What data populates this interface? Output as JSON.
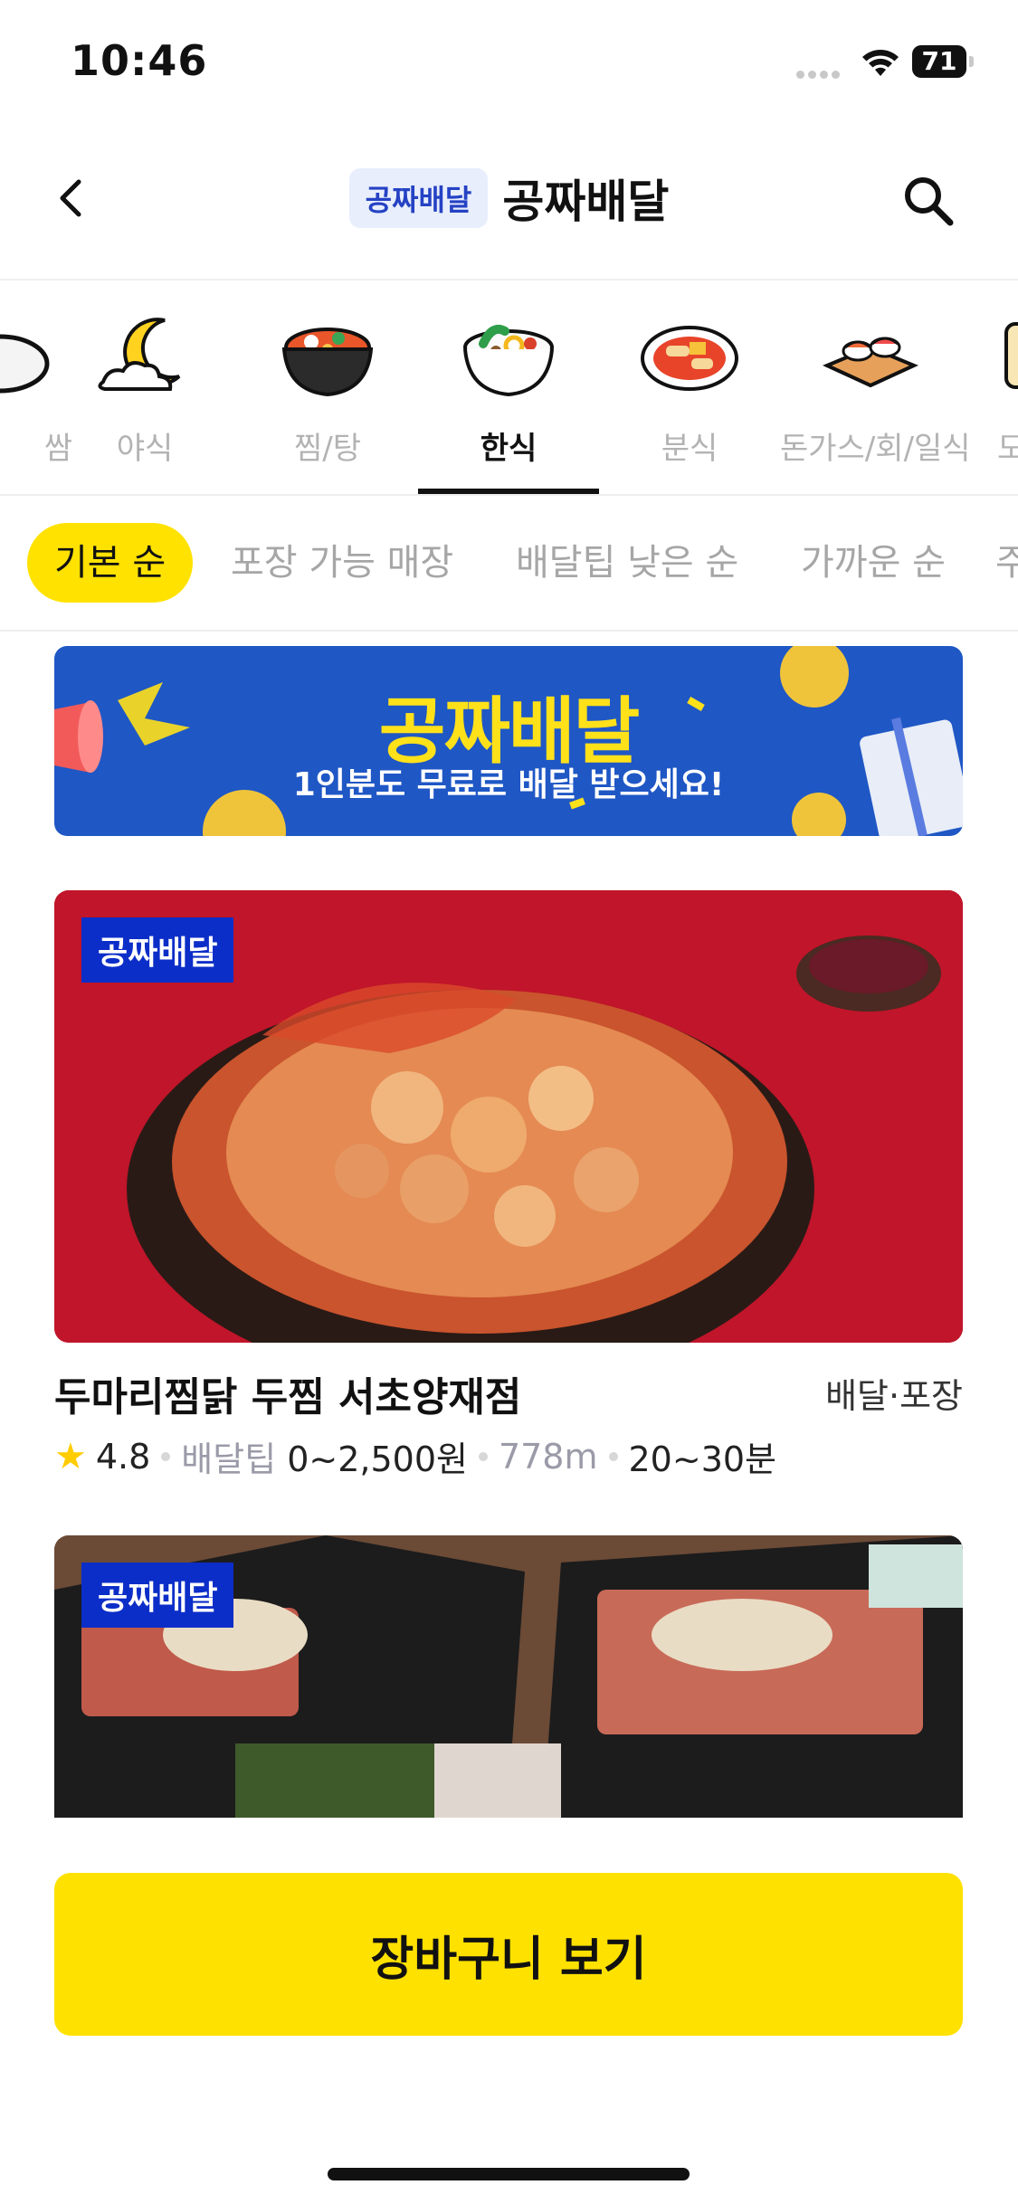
{
  "status_bar": {
    "time": "10:46",
    "battery": "71"
  },
  "header": {
    "badge": "공짜배달",
    "title": "공짜배달"
  },
  "categories": [
    {
      "label": "쌈",
      "icon": "wrap-icon"
    },
    {
      "label": "야식",
      "icon": "moon-icon"
    },
    {
      "label": "찜/탕",
      "icon": "stew-pot-icon"
    },
    {
      "label": "한식",
      "icon": "bibimbap-icon",
      "active": true
    },
    {
      "label": "분식",
      "icon": "tteokbokki-icon"
    },
    {
      "label": "돈가스/회/일식",
      "icon": "sushi-icon"
    },
    {
      "label": "도",
      "icon": "lunchbox-icon"
    }
  ],
  "filters": [
    {
      "label": "기본 순",
      "active": true
    },
    {
      "label": "포장 가능 매장"
    },
    {
      "label": "배달팁 낮은 순"
    },
    {
      "label": "가까운 순"
    },
    {
      "label": "주"
    }
  ],
  "banner": {
    "title": "공짜배달",
    "subtitle": "1인분도 무료로 배달 받으세요!"
  },
  "stores": [
    {
      "badge": "공짜배달",
      "name": "두마리찜닭 두찜 서초양재점",
      "type": "배달·포장",
      "rating": "4.8",
      "delivery_tip_label": "배달팁",
      "delivery_tip": "0~2,500원",
      "distance": "778m",
      "time": "20~30분"
    },
    {
      "badge": "공짜배달"
    }
  ],
  "cart_button": {
    "label": "장바구니 보기"
  },
  "colors": {
    "accent_yellow": "#ffe100",
    "badge_blue": "#0c2ec8",
    "banner_blue": "#1f57c5"
  }
}
